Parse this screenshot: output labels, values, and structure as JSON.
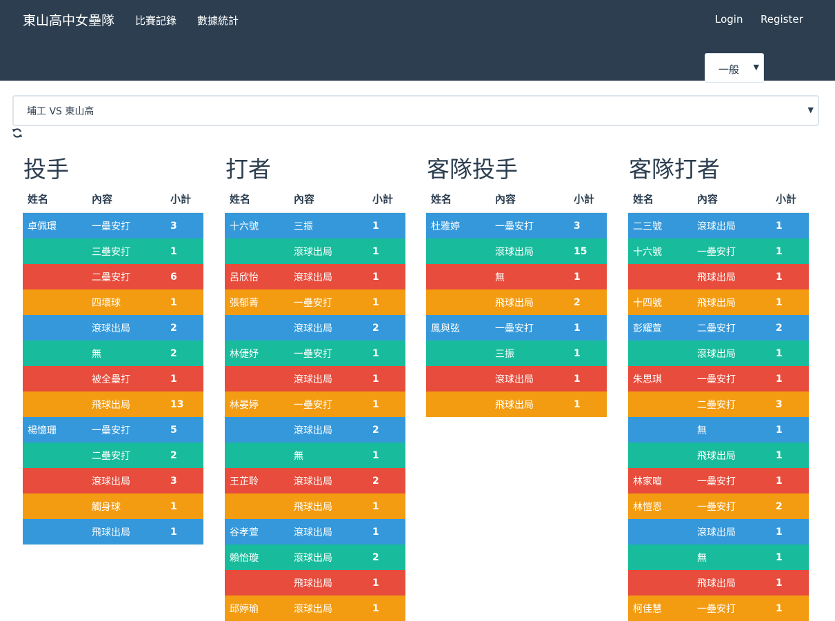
{
  "navbar": {
    "brand": "東山高中女壘隊",
    "links": [
      "比賽記錄",
      "數據統計"
    ],
    "login": "Login",
    "register": "Register",
    "mode_select": {
      "value": "一般"
    }
  },
  "game_select": {
    "value": "埔工 VS 東山高"
  },
  "panels": [
    {
      "title": "投手",
      "headers": [
        "姓名",
        "內容",
        "小計"
      ],
      "rows": [
        [
          "卓佩環",
          "一壘安打",
          "3"
        ],
        [
          "",
          "三壘安打",
          "1"
        ],
        [
          "",
          "二壘安打",
          "6"
        ],
        [
          "",
          "四壞球",
          "1"
        ],
        [
          "",
          "滾球出局",
          "2"
        ],
        [
          "",
          "無",
          "2"
        ],
        [
          "",
          "被全壘打",
          "1"
        ],
        [
          "",
          "飛球出局",
          "13"
        ],
        [
          "楊憶珊",
          "一壘安打",
          "5"
        ],
        [
          "",
          "二壘安打",
          "2"
        ],
        [
          "",
          "滾球出局",
          "3"
        ],
        [
          "",
          "觸身球",
          "1"
        ],
        [
          "",
          "飛球出局",
          "1"
        ]
      ]
    },
    {
      "title": "打者",
      "headers": [
        "姓名",
        "內容",
        "小計"
      ],
      "rows": [
        [
          "十六號",
          "三振",
          "1"
        ],
        [
          "",
          "滾球出局",
          "1"
        ],
        [
          "呂欣怡",
          "滾球出局",
          "1"
        ],
        [
          "張郁菁",
          "一壘安打",
          "1"
        ],
        [
          "",
          "滾球出局",
          "2"
        ],
        [
          "林倢妤",
          "一壘安打",
          "1"
        ],
        [
          "",
          "滾球出局",
          "1"
        ],
        [
          "林晏婷",
          "一壘安打",
          "1"
        ],
        [
          "",
          "滾球出局",
          "2"
        ],
        [
          "",
          "無",
          "1"
        ],
        [
          "王芷聆",
          "滾球出局",
          "2"
        ],
        [
          "",
          "飛球出局",
          "1"
        ],
        [
          "谷孝萱",
          "滾球出局",
          "1"
        ],
        [
          "賴怡璇",
          "滾球出局",
          "2"
        ],
        [
          "",
          "飛球出局",
          "1"
        ],
        [
          "邱婷瑜",
          "滾球出局",
          "1"
        ]
      ]
    },
    {
      "title": "客隊投手",
      "headers": [
        "姓名",
        "內容",
        "小計"
      ],
      "rows": [
        [
          "杜雅婷",
          "一壘安打",
          "3"
        ],
        [
          "",
          "滾球出局",
          "15"
        ],
        [
          "",
          "無",
          "1"
        ],
        [
          "",
          "飛球出局",
          "2"
        ],
        [
          "鳳與弦",
          "一壘安打",
          "1"
        ],
        [
          "",
          "三振",
          "1"
        ],
        [
          "",
          "滾球出局",
          "1"
        ],
        [
          "",
          "飛球出局",
          "1"
        ]
      ]
    },
    {
      "title": "客隊打者",
      "headers": [
        "姓名",
        "內容",
        "小計"
      ],
      "rows": [
        [
          "二三號",
          "滾球出局",
          "1"
        ],
        [
          "十六號",
          "一壘安打",
          "1"
        ],
        [
          "",
          "飛球出局",
          "1"
        ],
        [
          "十四號",
          "飛球出局",
          "1"
        ],
        [
          "彭耀萱",
          "二壘安打",
          "2"
        ],
        [
          "",
          "滾球出局",
          "1"
        ],
        [
          "朱思琪",
          "一壘安打",
          "1"
        ],
        [
          "",
          "二壘安打",
          "3"
        ],
        [
          "",
          "無",
          "1"
        ],
        [
          "",
          "飛球出局",
          "1"
        ],
        [
          "林家暄",
          "一壘安打",
          "1"
        ],
        [
          "林愷恩",
          "一壘安打",
          "2"
        ],
        [
          "",
          "滾球出局",
          "1"
        ],
        [
          "",
          "無",
          "1"
        ],
        [
          "",
          "飛球出局",
          "1"
        ],
        [
          "柯佳慧",
          "一壘安打",
          "1"
        ]
      ]
    }
  ],
  "colors": {
    "navbar": "#2c3e50",
    "row_cycle": [
      "#3498db",
      "#18bc9c",
      "#e74c3c",
      "#f39c12"
    ]
  },
  "icons": {
    "refresh": "refresh-icon"
  }
}
